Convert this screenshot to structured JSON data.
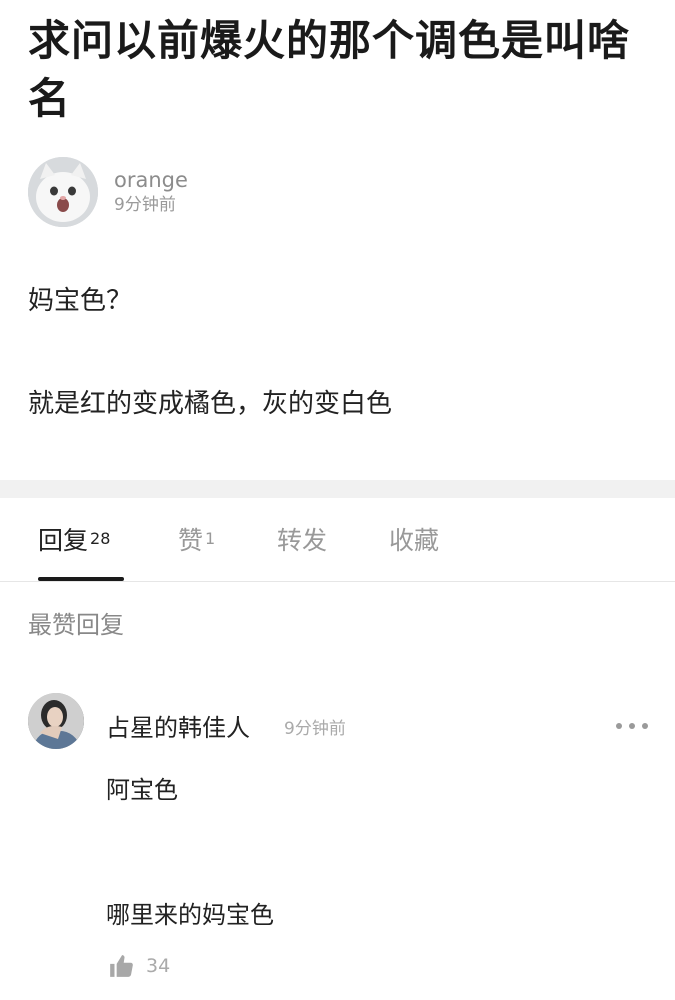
{
  "post": {
    "title": "求问以前爆火的那个调色是叫啥名",
    "author": {
      "name": "orange",
      "time": "9分钟前",
      "avatar_icon": "cat-avatar-icon"
    },
    "body_lines": [
      "妈宝色？",
      "就是红的变成橘色，灰的变白色"
    ]
  },
  "tabs": [
    {
      "label": "回复",
      "count": "28",
      "active": true
    },
    {
      "label": "赞",
      "count": "1",
      "active": false
    },
    {
      "label": "转发",
      "count": "",
      "active": false
    },
    {
      "label": "收藏",
      "count": "",
      "active": false
    }
  ],
  "section_label": "最赞回复",
  "comment": {
    "author": "占星的韩佳人",
    "time": "9分钟前",
    "lines": [
      "阿宝色",
      "哪里来的妈宝色"
    ],
    "likes": "34",
    "more_icon": "more-dots-icon",
    "like_icon": "thumbs-up-icon"
  }
}
